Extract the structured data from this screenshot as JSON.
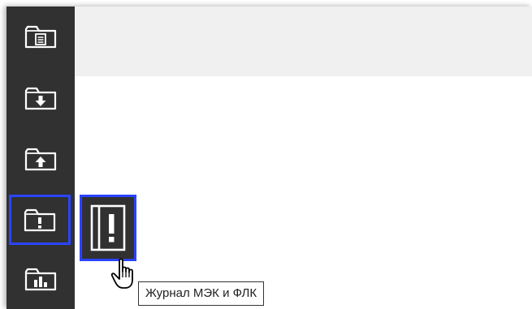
{
  "sidebar": {
    "items": [
      {
        "icon": "folder-document-icon",
        "selected": false
      },
      {
        "icon": "folder-download-icon",
        "selected": false
      },
      {
        "icon": "folder-upload-icon",
        "selected": false
      },
      {
        "icon": "folder-alert-icon",
        "selected": true
      },
      {
        "icon": "folder-chart-icon",
        "selected": false
      }
    ]
  },
  "flyout": {
    "icon": "journal-alert-icon"
  },
  "tooltip": {
    "text": "Журнал МЭК и ФЛК"
  },
  "colors": {
    "sidebar_bg": "#313131",
    "selection": "#2a44ff",
    "topbar_bg": "#f0f0f0",
    "content_bg": "#ffffff"
  }
}
